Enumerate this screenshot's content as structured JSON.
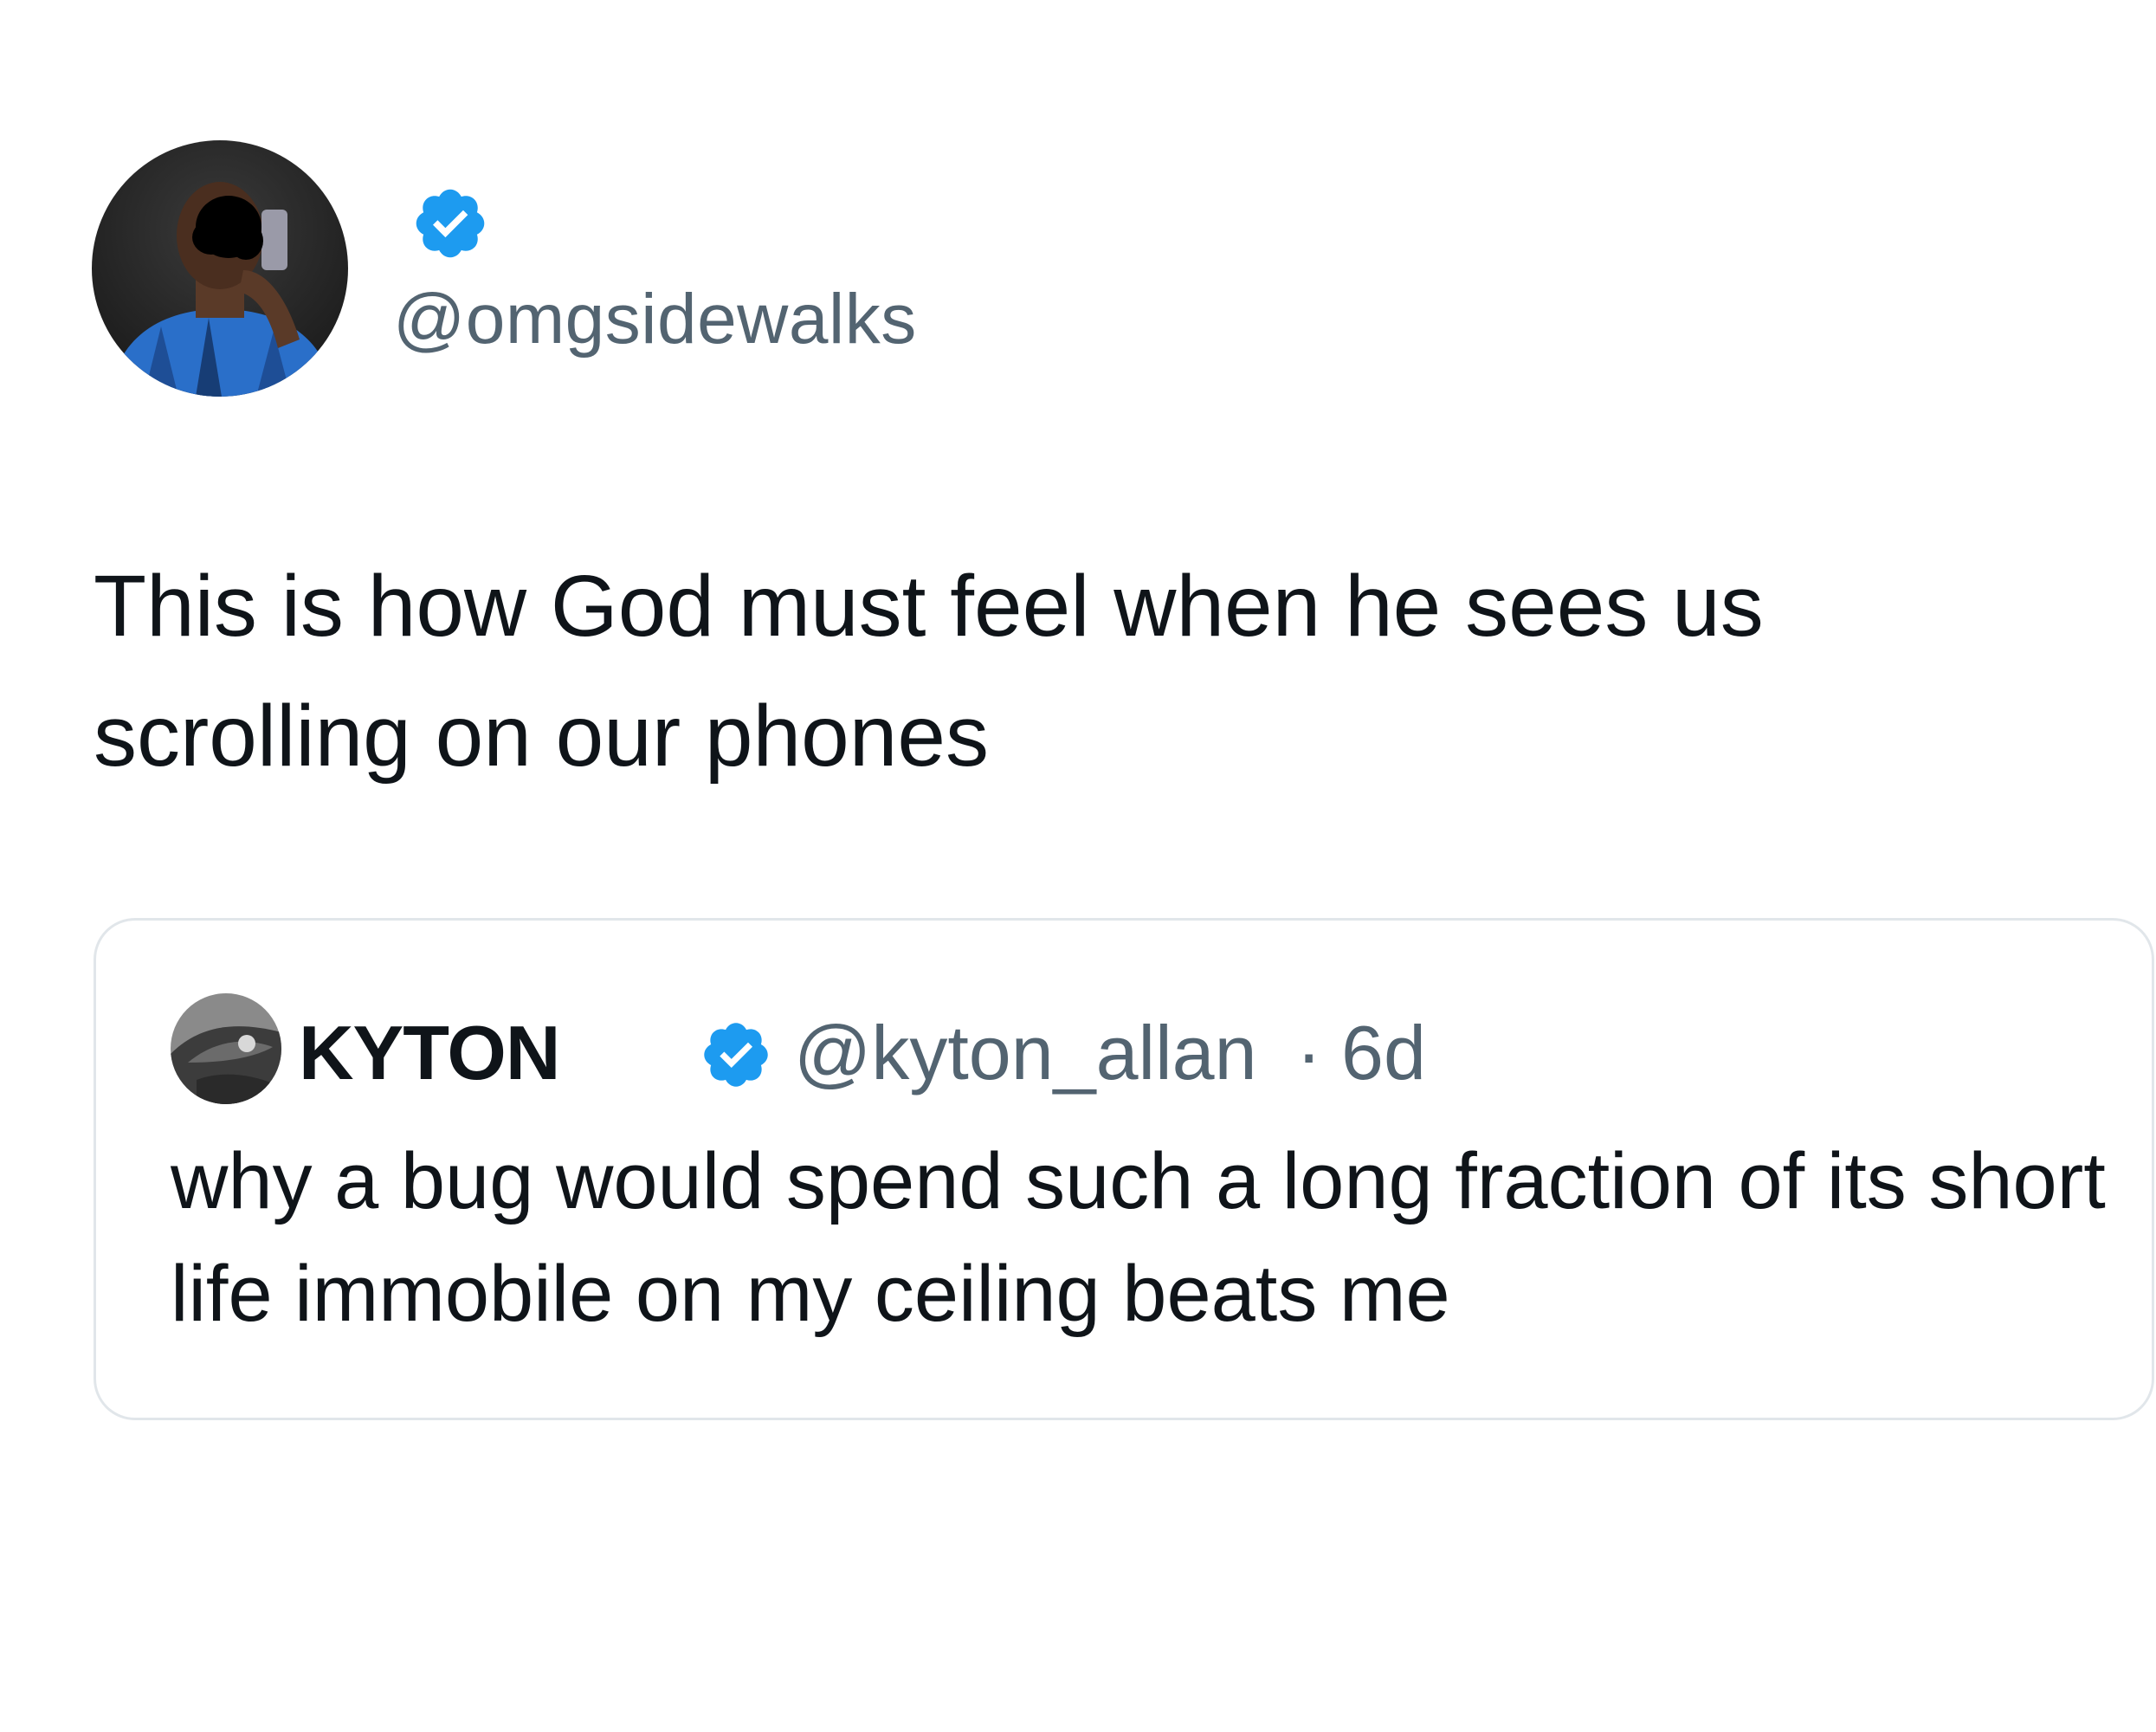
{
  "tweet": {
    "handle": "@omgsidewalks",
    "verified": true,
    "text": "This is how God must feel when he sees us scrolling on our phones",
    "avatar": "profile-photo"
  },
  "quoted_tweet": {
    "name": "KYTON",
    "verified": true,
    "handle": "@kyton_allan",
    "separator": "·",
    "time": "6d",
    "text": "why a bug would spend such a long fraction of its short life immobile on my ceiling beats me",
    "avatar": "profile-photo"
  },
  "colors": {
    "text_primary": "#0f1419",
    "text_secondary": "#536471",
    "verified_blue": "#1d9bf0",
    "card_border": "#e1e6ea",
    "background": "#ffffff"
  }
}
